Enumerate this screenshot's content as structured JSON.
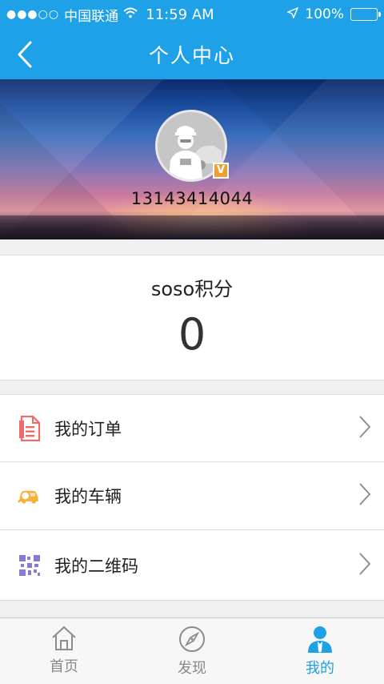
{
  "status": {
    "signal": "●●●○○",
    "carrier": "中国联通",
    "time": "11:59 AM",
    "battery": "100%"
  },
  "nav": {
    "title": "个人中心"
  },
  "profile": {
    "phone": "13143414044",
    "badge": "V"
  },
  "points": {
    "label": "soso积分",
    "value": "0"
  },
  "menu": [
    {
      "label": "我的订单",
      "icon": "order-icon",
      "color": "#f06a6a"
    },
    {
      "label": "我的车辆",
      "icon": "car-search-icon",
      "color": "#f5b13a"
    },
    {
      "label": "我的二维码",
      "icon": "qrcode-icon",
      "color": "#8a7ad6"
    }
  ],
  "tabs": [
    {
      "label": "首页",
      "icon": "home-icon"
    },
    {
      "label": "发现",
      "icon": "compass-icon"
    },
    {
      "label": "我的",
      "icon": "user-icon",
      "active": true
    }
  ],
  "colors": {
    "accent": "#1ea1e6"
  }
}
